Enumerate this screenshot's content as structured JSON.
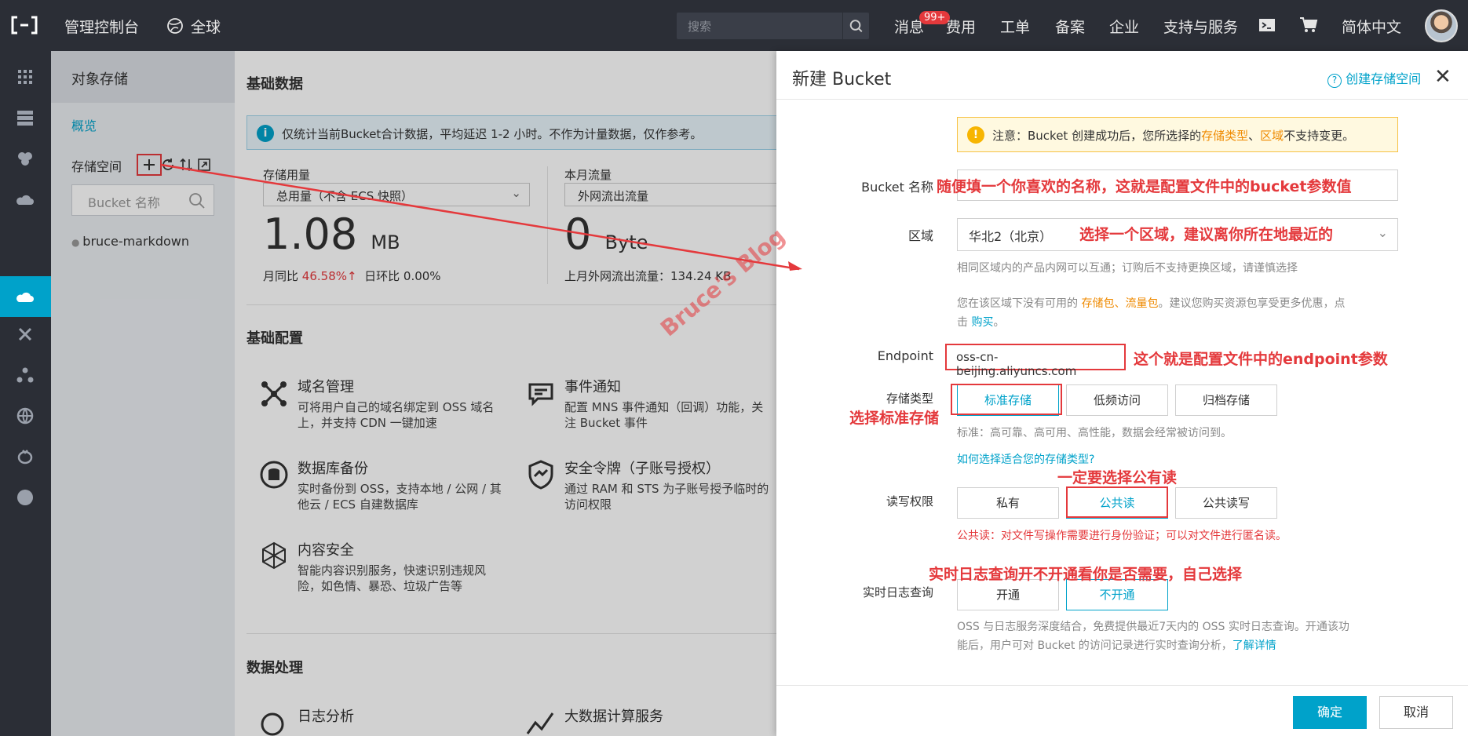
{
  "topbar": {
    "console": "管理控制台",
    "region": "全球",
    "search_placeholder": "搜索",
    "messages": "消息",
    "badge": "99+",
    "nav": [
      "费用",
      "工单",
      "备案",
      "企业",
      "支持与服务"
    ],
    "language": "简体中文"
  },
  "sidebar": {
    "title": "对象存储",
    "overview": "概览",
    "storage_space": "存储空间",
    "bucket_search_placeholder": "Bucket 名称",
    "bucket": "bruce-markdown"
  },
  "main": {
    "basic_data": "基础数据",
    "notice": "仅统计当前Bucket合计数据，平均延迟 1-2 小时。不作为计量数据，仅作参考。",
    "usage_label": "存储用量",
    "usage_select": "总用量（不含 ECS 快照）",
    "usage_value": "1.08",
    "usage_unit": "MB",
    "mom_label": "月同比",
    "mom_value": "46.58%↑",
    "dod_label": "日环比",
    "dod_value": "0.00%",
    "traffic_label": "本月流量",
    "traffic_select": "外网流出流量",
    "traffic_value": "0",
    "traffic_unit": "Byte",
    "last_month": "上月外网流出流量：134.24 KB",
    "basic_config": "基础配置",
    "features": [
      {
        "title": "域名管理",
        "desc": "可将用户自己的域名绑定到 OSS 域名上，并支持 CDN 一键加速"
      },
      {
        "title": "事件通知",
        "desc": "配置 MNS 事件通知（回调）功能，关注 Bucket 事件"
      },
      {
        "title": "数据库备份",
        "desc": "实时备份到 OSS，支持本地 / 公网 / 其他云 / ECS 自建数据库"
      },
      {
        "title": "安全令牌（子账号授权）",
        "desc": "通过 RAM 和 STS 为子账号授予临时的访问权限"
      },
      {
        "title": "内容安全",
        "desc": "智能内容识别服务，快速识别违规风险，如色情、暴恐、垃圾广告等"
      }
    ],
    "data_processing": "数据处理",
    "log_analysis": "日志分析",
    "bigdata": "大数据计算服务"
  },
  "panel": {
    "title": "新建 Bucket",
    "help": "创建存储空间",
    "warn_prefix": "注意：Bucket 创建成功后，您所选择的",
    "warn_type": "存储类型",
    "warn_sep": "、",
    "warn_region": "区域",
    "warn_suffix": "不支持变更。",
    "bucket_name_label": "Bucket 名称",
    "region_label": "区域",
    "region_value": "华北2（北京）",
    "region_hint": "相同区域内的产品内网可以互通；订购后不支持更换区域，请谨慎选择",
    "region_hint2_a": "您在该区域下没有可用的 ",
    "region_hint2_b": "存储包、流量包",
    "region_hint2_c": "。建议您购买资源包享受更多优惠，点",
    "region_hint2_d": "击 ",
    "region_hint2_e": "购买",
    "region_hint2_f": "。",
    "endpoint_label": "Endpoint",
    "endpoint_value": "oss-cn-beijing.aliyuncs.com",
    "storage_type_label": "存储类型",
    "storage_types": [
      "标准存储",
      "低频访问",
      "归档存储"
    ],
    "storage_hint": "标准：高可靠、高可用、高性能，数据会经常被访问到。",
    "storage_link": "如何选择适合您的存储类型?",
    "acl_label": "读写权限",
    "acl_options": [
      "私有",
      "公共读",
      "公共读写"
    ],
    "acl_hint": "公共读：对文件写操作需要进行身份验证；可以对文件进行匿名读。",
    "log_label": "实时日志查询",
    "log_options": [
      "开通",
      "不开通"
    ],
    "log_hint_a": "OSS 与日志服务深度结合，免费提供最近7天内的 OSS 实时日志查询。开通该功",
    "log_hint_b": "能后，用户可对 Bucket 的访问记录进行实时查询分析，",
    "log_link": "了解详情",
    "ok": "确定",
    "cancel": "取消"
  },
  "annotations": {
    "name": "随便填一个你喜欢的名称，这就是配置文件中的bucket参数值",
    "region": "选择一个区域，建议离你所在地最近的",
    "endpoint": "这个就是配置文件中的endpoint参数",
    "storage": "选择标准存储",
    "acl": "一定要选择公有读",
    "log": "实时日志查询开不开通看你是否需要，自己选择",
    "watermark": "Bruce's Blog"
  },
  "colors": {
    "accent": "#00a2ca",
    "annotation": "#e4393c",
    "topbar": "#2b2e36"
  }
}
